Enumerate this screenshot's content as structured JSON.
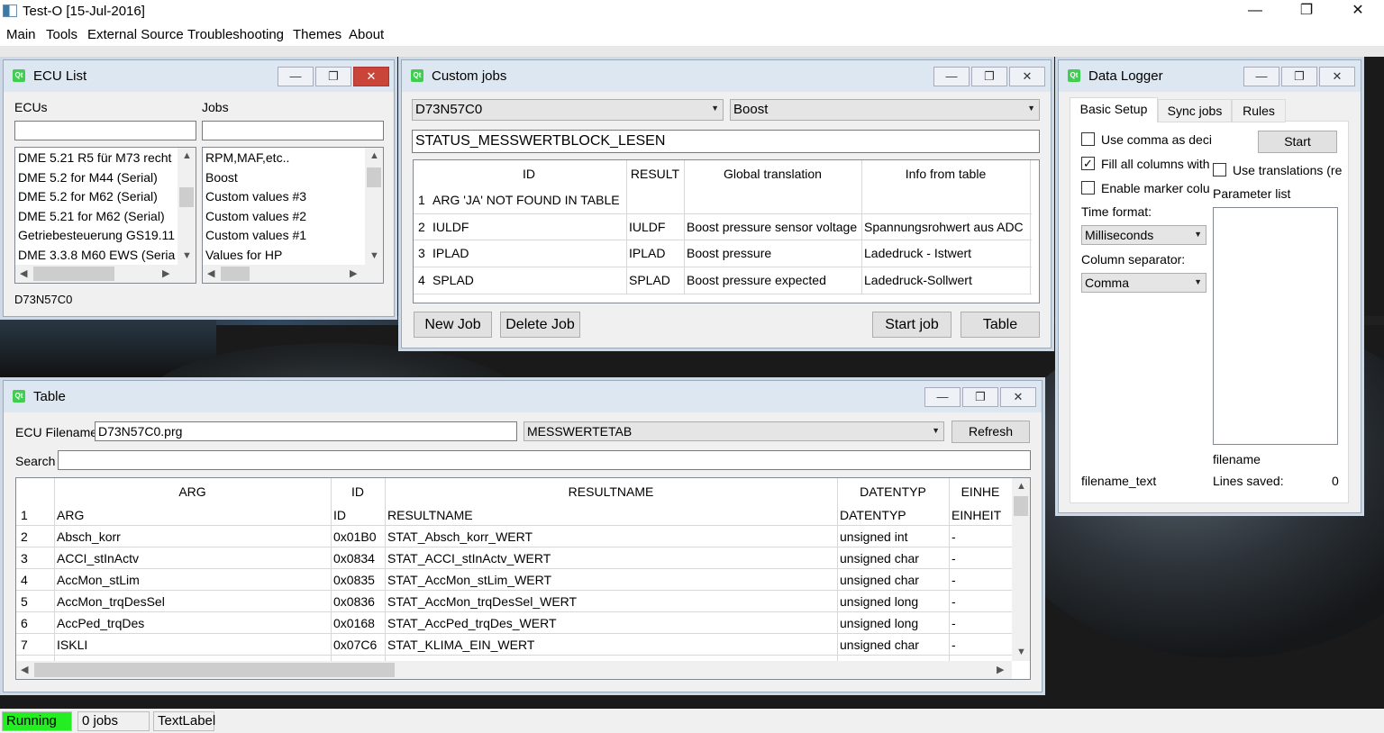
{
  "app": {
    "title": "Test-O [15-Jul-2016]",
    "controls": {
      "minimize": "—",
      "maximize": "❐",
      "close": "✕"
    }
  },
  "menu": [
    "Main",
    "Tools",
    "External Source",
    "Troubleshooting",
    "Themes",
    "About"
  ],
  "ecu_list": {
    "title": "ECU List",
    "ecus_label": "ECUs",
    "jobs_label": "Jobs",
    "ecus": [
      "DME 5.21 R5 für M73 recht",
      "DME 5.2 for M44 (Serial)",
      "DME 5.2 for M62 (Serial)",
      "DME 5.21 for M62 (Serial)",
      "Getriebesteuerung GS19.11",
      "DME 3.3.8 M60 EWS (Seria"
    ],
    "jobs": [
      "RPM,MAF,etc..",
      "Boost",
      "Custom values #3",
      "Custom values #2",
      "Custom values #1",
      "Values for HP"
    ],
    "selected_ecu": "D73N57C0"
  },
  "custom_jobs": {
    "title": "Custom jobs",
    "ecu_combo": "D73N57C0",
    "job_combo": "Boost",
    "job_name": "STATUS_MESSWERTBLOCK_LESEN",
    "columns": [
      "ID",
      "RESULT",
      "Global translation",
      "Info from table"
    ],
    "rows": [
      {
        "n": "1",
        "id": "ARG 'JA' NOT FOUND IN TABLE",
        "result": "",
        "translation": "",
        "info": ""
      },
      {
        "n": "2",
        "id": "IULDF",
        "result": "IULDF",
        "translation": "Boost pressure sensor voltage",
        "info": "Spannungsrohwert aus ADC"
      },
      {
        "n": "3",
        "id": "IPLAD",
        "result": "IPLAD",
        "translation": "Boost pressure",
        "info": "Ladedruck - Istwert"
      },
      {
        "n": "4",
        "id": "SPLAD",
        "result": "SPLAD",
        "translation": "Boost pressure expected",
        "info": "Ladedruck-Sollwert"
      }
    ],
    "buttons": {
      "new_job": "New Job",
      "delete_job": "Delete Job",
      "start_job": "Start job",
      "table": "Table"
    }
  },
  "data_logger": {
    "title": "Data Logger",
    "tabs": [
      "Basic Setup",
      "Sync jobs",
      "Rules"
    ],
    "use_comma": "Use comma as deci",
    "fill_all": "Fill all columns with",
    "enable_marker": "Enable marker colu",
    "use_translations": "Use translations (re",
    "start": "Start",
    "parameter_list": "Parameter list",
    "time_format_label": "Time format:",
    "time_format": "Milliseconds",
    "column_separator_label": "Column separator:",
    "column_separator": "Comma",
    "filename": "filename",
    "filename_text": "filename_text",
    "lines_saved_label": "Lines saved:",
    "lines_saved": "0"
  },
  "table_win": {
    "title": "Table",
    "ecu_filename_label": "ECU Filename",
    "ecu_filename": "D73N57C0.prg",
    "table_combo": "MESSWERTETAB",
    "refresh": "Refresh",
    "search_label": "Search",
    "search_value": "",
    "columns": [
      "ARG",
      "ID",
      "RESULTNAME",
      "DATENTYP",
      "EINHE"
    ],
    "rows": [
      {
        "n": "1",
        "arg": "ARG",
        "id": "ID",
        "resultname": "RESULTNAME",
        "datentyp": "DATENTYP",
        "einheit": "EINHEIT"
      },
      {
        "n": "2",
        "arg": "Absch_korr",
        "id": "0x01B0",
        "resultname": "STAT_Absch_korr_WERT",
        "datentyp": "unsigned int",
        "einheit": "-"
      },
      {
        "n": "3",
        "arg": "ACCI_stInActv",
        "id": "0x0834",
        "resultname": "STAT_ACCI_stInActv_WERT",
        "datentyp": "unsigned char",
        "einheit": "-"
      },
      {
        "n": "4",
        "arg": "AccMon_stLim",
        "id": "0x0835",
        "resultname": "STAT_AccMon_stLim_WERT",
        "datentyp": "unsigned char",
        "einheit": "-"
      },
      {
        "n": "5",
        "arg": "AccMon_trqDesSel",
        "id": "0x0836",
        "resultname": "STAT_AccMon_trqDesSel_WERT",
        "datentyp": "unsigned long",
        "einheit": "-"
      },
      {
        "n": "6",
        "arg": "AccPed_trqDes",
        "id": "0x0168",
        "resultname": "STAT_AccPed_trqDes_WERT",
        "datentyp": "unsigned long",
        "einheit": "-"
      },
      {
        "n": "7",
        "arg": "ISKLI",
        "id": "0x07C6",
        "resultname": "STAT_KLIMA_EIN_WERT",
        "datentyp": "unsigned char",
        "einheit": "-"
      }
    ]
  },
  "status": {
    "running": "Running",
    "jobs": "0 jobs",
    "label": "TextLabel",
    "running_color": "#22ee22"
  }
}
